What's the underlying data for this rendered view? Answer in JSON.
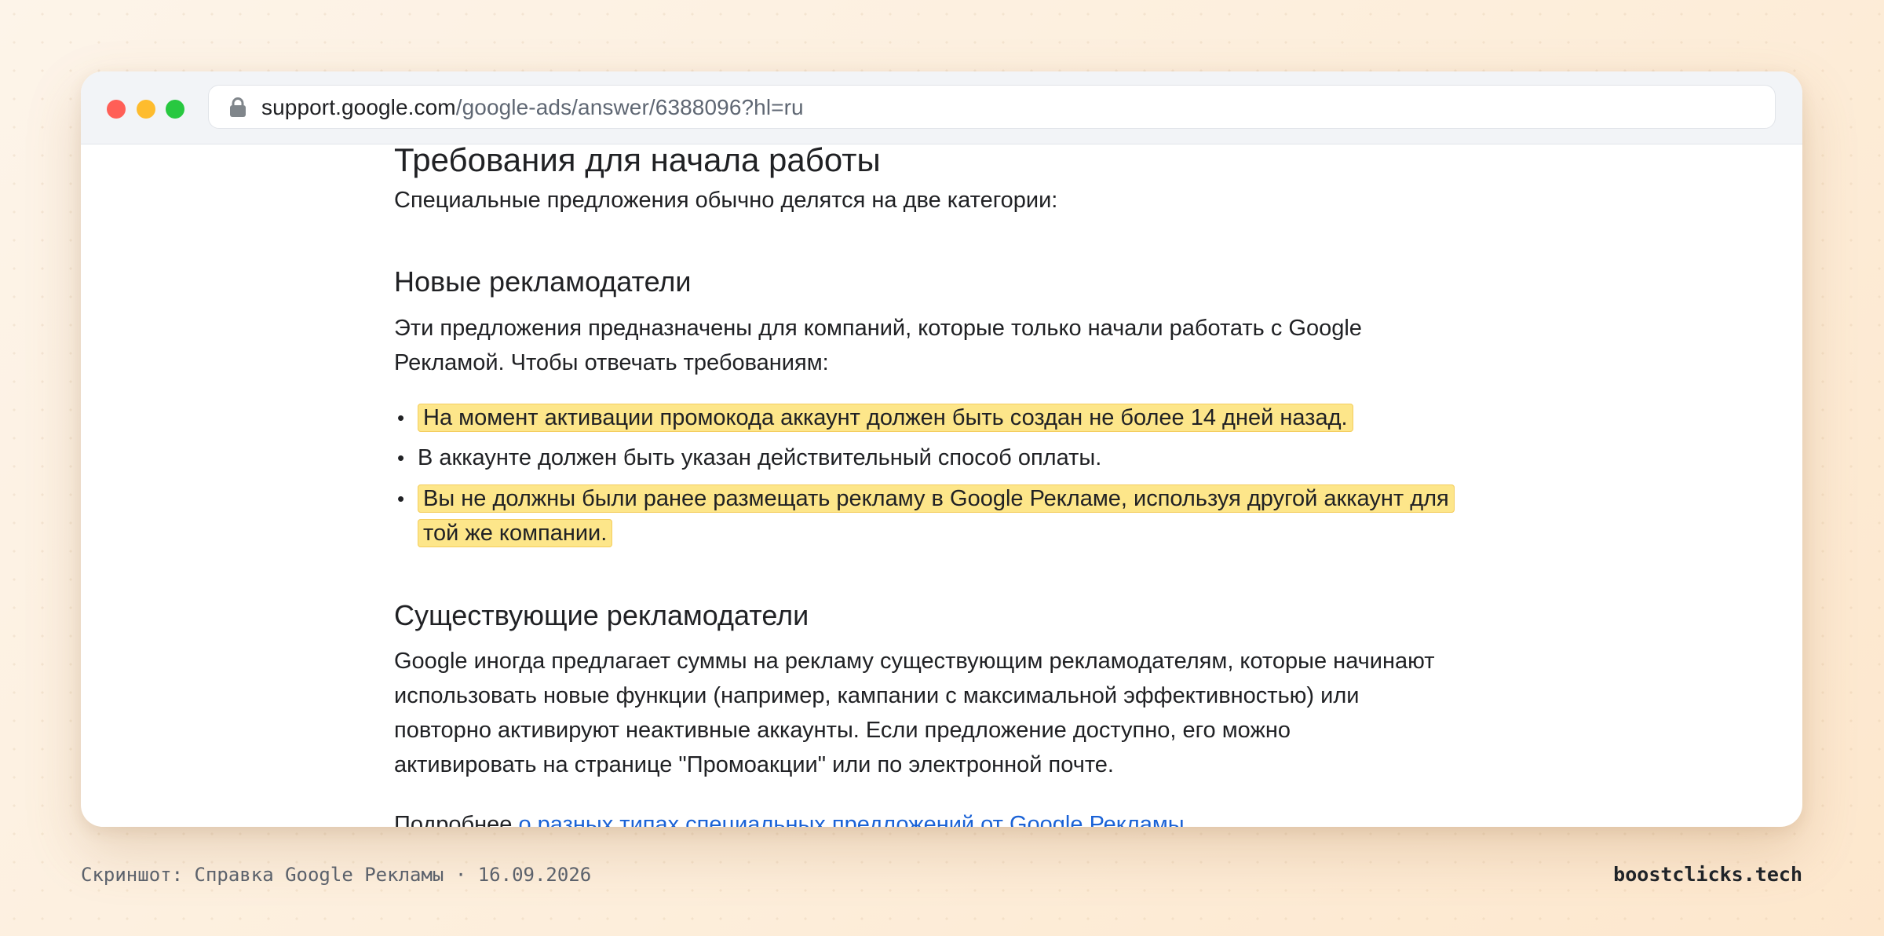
{
  "browser": {
    "url_domain": "support.google.com",
    "url_path": "/google-ads/answer/6388096?hl=ru",
    "lock_icon": "lock-icon",
    "traffic_lights": {
      "close": "#ff5f57",
      "minimize": "#febc2e",
      "zoom": "#28c840"
    }
  },
  "article": {
    "heading": "Требования для начала работы",
    "intro": "Специальные предложения обычно делятся на две категории:",
    "new_advertisers": {
      "heading": "Новые рекламодатели",
      "paragraph_line_1": "Эти предложения предназначены для компаний, которые только начали работать с Google",
      "paragraph_line_2": "Рекламой. Чтобы отвечать требованиям:",
      "bullets": [
        {
          "text": "На момент активации промокода аккаунт должен быть создан не более 14 дней назад.",
          "highlighted": true
        },
        {
          "text": "В аккаунте должен быть указан действительный способ оплаты.",
          "highlighted": false
        },
        {
          "text_line_1": "Вы не должны были ранее размещать рекламу в Google Рекламе, используя другой аккаунт для",
          "text_line_2": "той же компании.",
          "highlighted": true
        }
      ]
    },
    "existing_advertisers": {
      "heading": "Существующие рекламодатели",
      "paragraph_lines": [
        "Google иногда предлагает суммы на рекламу существующим рекламодателям, которые начинают",
        "использовать новые функции (например, кампании с максимальной эффективностью) или",
        "повторно активируют неактивные аккаунты. Если предложение доступно, его можно",
        "активировать на странице \"Промоакции\" или по электронной почте."
      ],
      "more_prefix": "Подробнее ",
      "more_link": "о разных типах специальных предложений от Google Рекламы",
      "more_suffix": "..."
    }
  },
  "footer": {
    "caption": "Скриншот: Справка Google Рекламы · 16.09.2026",
    "brand": "boostclicks.tech"
  },
  "colors": {
    "highlight": "#fde68a",
    "link": "#1a62d6",
    "text": "#202124"
  }
}
